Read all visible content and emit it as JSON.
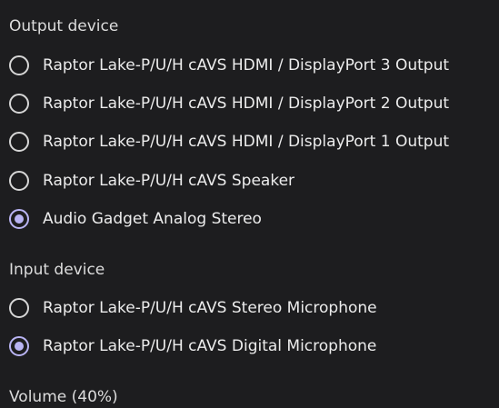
{
  "output_section": {
    "title": "Output device",
    "options": [
      {
        "label": "Raptor Lake-P/U/H cAVS HDMI / DisplayPort 3 Output",
        "selected": false
      },
      {
        "label": "Raptor Lake-P/U/H cAVS HDMI / DisplayPort 2 Output",
        "selected": false
      },
      {
        "label": "Raptor Lake-P/U/H cAVS HDMI / DisplayPort 1 Output",
        "selected": false
      },
      {
        "label": "Raptor Lake-P/U/H cAVS Speaker",
        "selected": false
      },
      {
        "label": "Audio Gadget Analog Stereo",
        "selected": true
      }
    ]
  },
  "input_section": {
    "title": "Input device",
    "options": [
      {
        "label": "Raptor Lake-P/U/H cAVS Stereo Microphone",
        "selected": false
      },
      {
        "label": "Raptor Lake-P/U/H cAVS Digital Microphone",
        "selected": true
      }
    ]
  },
  "volume_section": {
    "title": "Volume (40%)"
  },
  "colors": {
    "background": "#1d1d1f",
    "accent": "#b9b4f3",
    "radio_border": "#d6d6d6",
    "text": "#ececec"
  }
}
